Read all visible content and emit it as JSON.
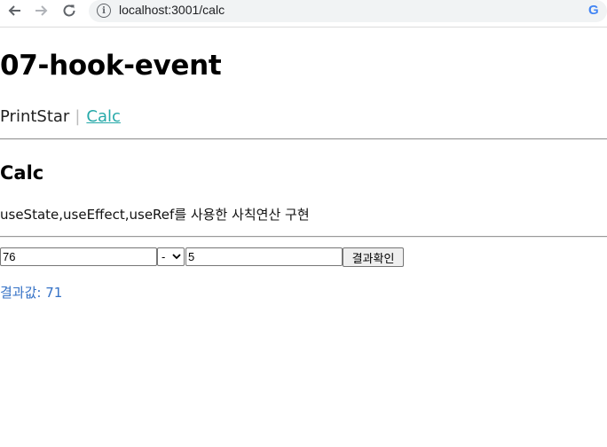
{
  "browser": {
    "url": "localhost:3001/calc",
    "icons": {
      "back": "back-arrow-icon",
      "forward": "forward-arrow-icon",
      "reload": "reload-icon",
      "site_info": "info-icon",
      "google": "google-icon"
    }
  },
  "page": {
    "title": "07-hook-event",
    "nav": {
      "items": [
        {
          "label": "PrintStar",
          "active": false
        },
        {
          "label": "Calc",
          "active": true
        }
      ],
      "separator": "|"
    },
    "section_title": "Calc",
    "description": "useState,useEffect,useRef를 사용한 사칙연산 구현",
    "calculator": {
      "operand_a": "76",
      "operator": "-",
      "operand_b": "5",
      "button_label": "결과확인"
    },
    "result_text": "결과값: 71"
  },
  "colors": {
    "active_link": "#26a9a9",
    "result_text": "#3572c6",
    "address_bar_bg": "#f1f3f4"
  }
}
